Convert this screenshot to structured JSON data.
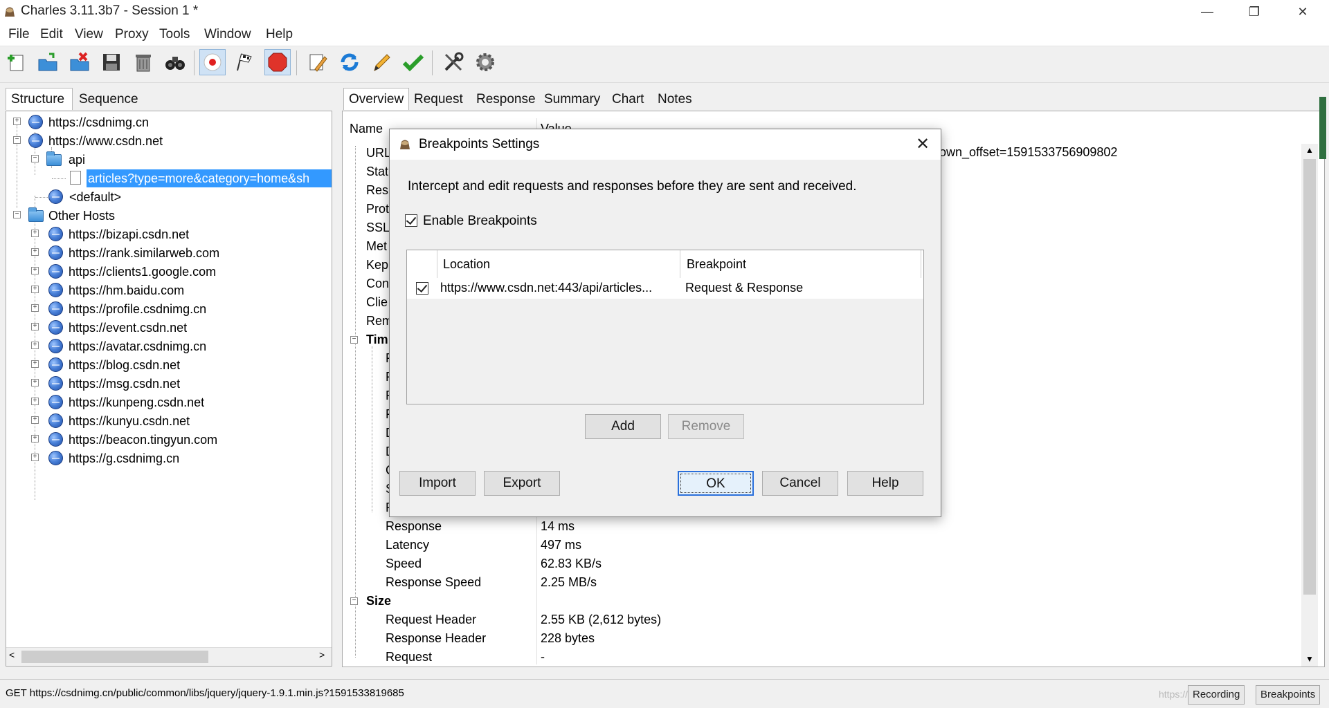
{
  "window": {
    "title": "Charles 3.11.3b7 - Session 1 *",
    "controls": {
      "minimize": "—",
      "restore": "❐",
      "close": "✕"
    }
  },
  "menu": [
    "File",
    "Edit",
    "View",
    "Proxy",
    "Tools",
    "Window",
    "Help"
  ],
  "toolbar": {
    "icons": [
      "new-session-icon",
      "open-session-icon",
      "close-session-icon",
      "save-session-icon",
      "clear-session-icon",
      "find-icon",
      "record-icon",
      "throttle-icon",
      "breakpoints-icon",
      "compose-icon",
      "repeat-icon",
      "edit-icon",
      "validate-icon",
      "tools-icon",
      "settings-icon"
    ]
  },
  "left": {
    "tabs": [
      "Structure",
      "Sequence"
    ],
    "tree": [
      {
        "label": "https://csdnimg.cn"
      },
      {
        "label": "https://www.csdn.net"
      },
      {
        "label": "api"
      },
      {
        "label": "articles?type=more&category=home&sh"
      },
      {
        "label": "<default>"
      },
      {
        "label": "Other Hosts"
      },
      {
        "label": "https://bizapi.csdn.net"
      },
      {
        "label": "https://rank.similarweb.com"
      },
      {
        "label": "https://clients1.google.com"
      },
      {
        "label": "https://hm.baidu.com"
      },
      {
        "label": "https://profile.csdnimg.cn"
      },
      {
        "label": "https://event.csdn.net"
      },
      {
        "label": "https://avatar.csdnimg.cn"
      },
      {
        "label": "https://blog.csdn.net"
      },
      {
        "label": "https://msg.csdn.net"
      },
      {
        "label": "https://kunpeng.csdn.net"
      },
      {
        "label": "https://kunyu.csdn.net"
      },
      {
        "label": "https://beacon.tingyun.com"
      },
      {
        "label": "https://g.csdnimg.cn"
      }
    ]
  },
  "right": {
    "tabs": [
      "Overview",
      "Request",
      "Response",
      "Summary",
      "Chart",
      "Notes"
    ],
    "columns": {
      "name": "Name",
      "value": "Value"
    },
    "url_value_tail": "own_offset=1591533756909802",
    "rows": [
      {
        "name": "URL"
      },
      {
        "name": "Stat"
      },
      {
        "name": "Resp"
      },
      {
        "name": "Prot"
      },
      {
        "name": "SSL"
      },
      {
        "name": "Met"
      },
      {
        "name": "Kep"
      },
      {
        "name": "Con"
      },
      {
        "name": "Clie"
      },
      {
        "name": "Rem"
      },
      {
        "name": "Tim"
      },
      {
        "name": "F"
      },
      {
        "name": "F"
      },
      {
        "name": "F"
      },
      {
        "name": "F"
      },
      {
        "name": "D"
      },
      {
        "name": "D"
      },
      {
        "name": "C"
      },
      {
        "name": "S"
      },
      {
        "name": "F"
      },
      {
        "name": "Response",
        "value": "14 ms"
      },
      {
        "name": "Latency",
        "value": "497 ms"
      },
      {
        "name": "Speed",
        "value": "62.83 KB/s"
      },
      {
        "name": "Response Speed",
        "value": "2.25 MB/s"
      },
      {
        "name": "Size"
      },
      {
        "name": "Request Header",
        "value": "2.55 KB (2,612 bytes)"
      },
      {
        "name": "Response Header",
        "value": "228 bytes"
      },
      {
        "name": "Request",
        "value": "-"
      }
    ]
  },
  "status": {
    "text": "GET https://csdnimg.cn/public/common/libs/jquery/jquery-1.9.1.min.js?1591533819685",
    "watermark": "https://",
    "recording": "Recording",
    "breakpoints": "Breakpoints"
  },
  "dialog": {
    "title": "Breakpoints Settings",
    "description": "Intercept and edit requests and responses before they are sent and received.",
    "enable_label": "Enable Breakpoints",
    "enable_checked": true,
    "table": {
      "headers": [
        "Location",
        "Breakpoint"
      ],
      "rows": [
        {
          "checked": true,
          "location": "https://www.csdn.net:443/api/articles...",
          "breakpoint": "Request & Response"
        }
      ]
    },
    "buttons": {
      "add": "Add",
      "remove": "Remove",
      "import": "Import",
      "export": "Export",
      "ok": "OK",
      "cancel": "Cancel",
      "help": "Help"
    }
  }
}
